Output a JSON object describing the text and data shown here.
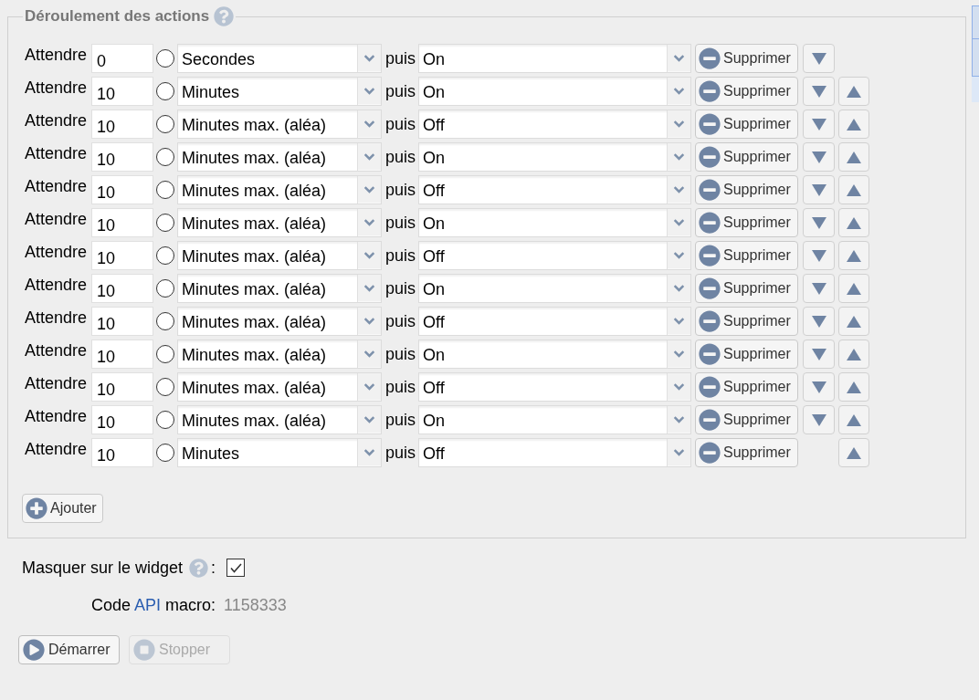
{
  "actions_panel": {
    "title": "Déroulement des actions",
    "rows": [
      {
        "label": "Attendre",
        "duration": "0",
        "selected": false,
        "unit": "Secondes",
        "connector": "puis",
        "action": "On",
        "delete_label": "Supprimer",
        "can_move_down": true,
        "can_move_up": false
      },
      {
        "label": "Attendre",
        "duration": "10",
        "selected": false,
        "unit": "Minutes",
        "connector": "puis",
        "action": "On",
        "delete_label": "Supprimer",
        "can_move_down": true,
        "can_move_up": true
      },
      {
        "label": "Attendre",
        "duration": "10",
        "selected": false,
        "unit": "Minutes max. (aléa)",
        "connector": "puis",
        "action": "Off",
        "delete_label": "Supprimer",
        "can_move_down": true,
        "can_move_up": true
      },
      {
        "label": "Attendre",
        "duration": "10",
        "selected": false,
        "unit": "Minutes max. (aléa)",
        "connector": "puis",
        "action": "On",
        "delete_label": "Supprimer",
        "can_move_down": true,
        "can_move_up": true
      },
      {
        "label": "Attendre",
        "duration": "10",
        "selected": false,
        "unit": "Minutes max. (aléa)",
        "connector": "puis",
        "action": "Off",
        "delete_label": "Supprimer",
        "can_move_down": true,
        "can_move_up": true
      },
      {
        "label": "Attendre",
        "duration": "10",
        "selected": false,
        "unit": "Minutes max. (aléa)",
        "connector": "puis",
        "action": "On",
        "delete_label": "Supprimer",
        "can_move_down": true,
        "can_move_up": true
      },
      {
        "label": "Attendre",
        "duration": "10",
        "selected": false,
        "unit": "Minutes max. (aléa)",
        "connector": "puis",
        "action": "Off",
        "delete_label": "Supprimer",
        "can_move_down": true,
        "can_move_up": true
      },
      {
        "label": "Attendre",
        "duration": "10",
        "selected": false,
        "unit": "Minutes max. (aléa)",
        "connector": "puis",
        "action": "On",
        "delete_label": "Supprimer",
        "can_move_down": true,
        "can_move_up": true
      },
      {
        "label": "Attendre",
        "duration": "10",
        "selected": false,
        "unit": "Minutes max. (aléa)",
        "connector": "puis",
        "action": "Off",
        "delete_label": "Supprimer",
        "can_move_down": true,
        "can_move_up": true
      },
      {
        "label": "Attendre",
        "duration": "10",
        "selected": false,
        "unit": "Minutes max. (aléa)",
        "connector": "puis",
        "action": "On",
        "delete_label": "Supprimer",
        "can_move_down": true,
        "can_move_up": true
      },
      {
        "label": "Attendre",
        "duration": "10",
        "selected": false,
        "unit": "Minutes max. (aléa)",
        "connector": "puis",
        "action": "Off",
        "delete_label": "Supprimer",
        "can_move_down": true,
        "can_move_up": true
      },
      {
        "label": "Attendre",
        "duration": "10",
        "selected": false,
        "unit": "Minutes max. (aléa)",
        "connector": "puis",
        "action": "On",
        "delete_label": "Supprimer",
        "can_move_down": true,
        "can_move_up": true
      },
      {
        "label": "Attendre",
        "duration": "10",
        "selected": false,
        "unit": "Minutes",
        "connector": "puis",
        "action": "Off",
        "delete_label": "Supprimer",
        "can_move_down": false,
        "can_move_up": true
      }
    ],
    "add_button": "Ajouter"
  },
  "hide_on_widget": {
    "label": "Masquer sur le widget",
    "suffix": ":",
    "checked": true
  },
  "api_code": {
    "label_start": "Code",
    "link": "API",
    "label_end": "macro:",
    "value": "1158333"
  },
  "buttons": [
    {
      "label": "Démarrer",
      "kind": "start",
      "disabled": false
    },
    {
      "label": "Stopper",
      "kind": "stop",
      "disabled": true
    }
  ]
}
